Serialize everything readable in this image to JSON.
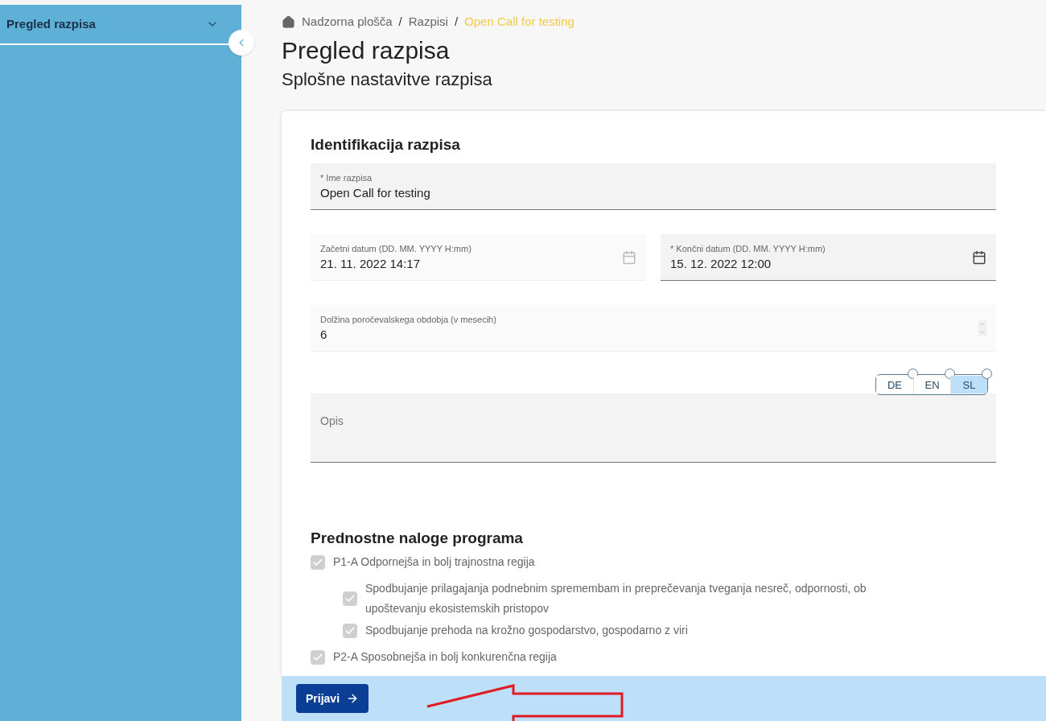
{
  "sidebar": {
    "items": [
      {
        "label": "Pregled razpisa",
        "expanded": false
      }
    ]
  },
  "breadcrumb": [
    {
      "label": "Nadzorna plošča",
      "selected": false
    },
    {
      "separator": "/",
      "label": "Razpisi",
      "selected": false
    },
    {
      "separator": "/",
      "label": "Open Call for testing",
      "selected": true
    }
  ],
  "page": {
    "title": "Pregled razpisa",
    "subtitle": "Splošne nastavitve razpisa"
  },
  "identification": {
    "heading": "Identifikacija razpisa",
    "name_field": {
      "label": "* Ime razpisa",
      "value": "Open Call for testing"
    },
    "date_fields": [
      {
        "label": "Začetni datum (DD. MM. YYYY H:mm)",
        "value": "21. 11. 2022 14:17",
        "disabled": true
      },
      {
        "label": "* Končni datum (DD. MM. YYYY H:mm)",
        "value": "15. 12. 2022 12:00",
        "disabled": false
      }
    ],
    "period_field": {
      "label": "Dolžina poročevalskega obdobja (v mesecih)",
      "value": "6"
    },
    "languages": [
      {
        "label": "DE",
        "selected": false
      },
      {
        "label": "EN",
        "selected": false
      },
      {
        "label": "SL",
        "selected": true
      }
    ],
    "description_field": {
      "placeholder": "Opis"
    }
  },
  "priorities": {
    "heading": "Prednostne naloge programa",
    "items": [
      {
        "label": "P1-A Odpornejša in bolj trajnostna regija",
        "checked": true,
        "children": [
          {
            "label": "Spodbujanje prilagajanja podnebnim spremembam in preprečevanja tveganja nesreč, odpornosti, ob upoštevanju ekosistemskih pristopov",
            "checked": true
          },
          {
            "label": "Spodbujanje prehoda na krožno gospodarstvo, gospodarno z viri",
            "checked": true
          }
        ]
      },
      {
        "label": "P2-A Sposobnejša in bolj konkurenčna regija",
        "checked": true
      }
    ]
  },
  "submit_button": {
    "label": "Prijavi"
  }
}
